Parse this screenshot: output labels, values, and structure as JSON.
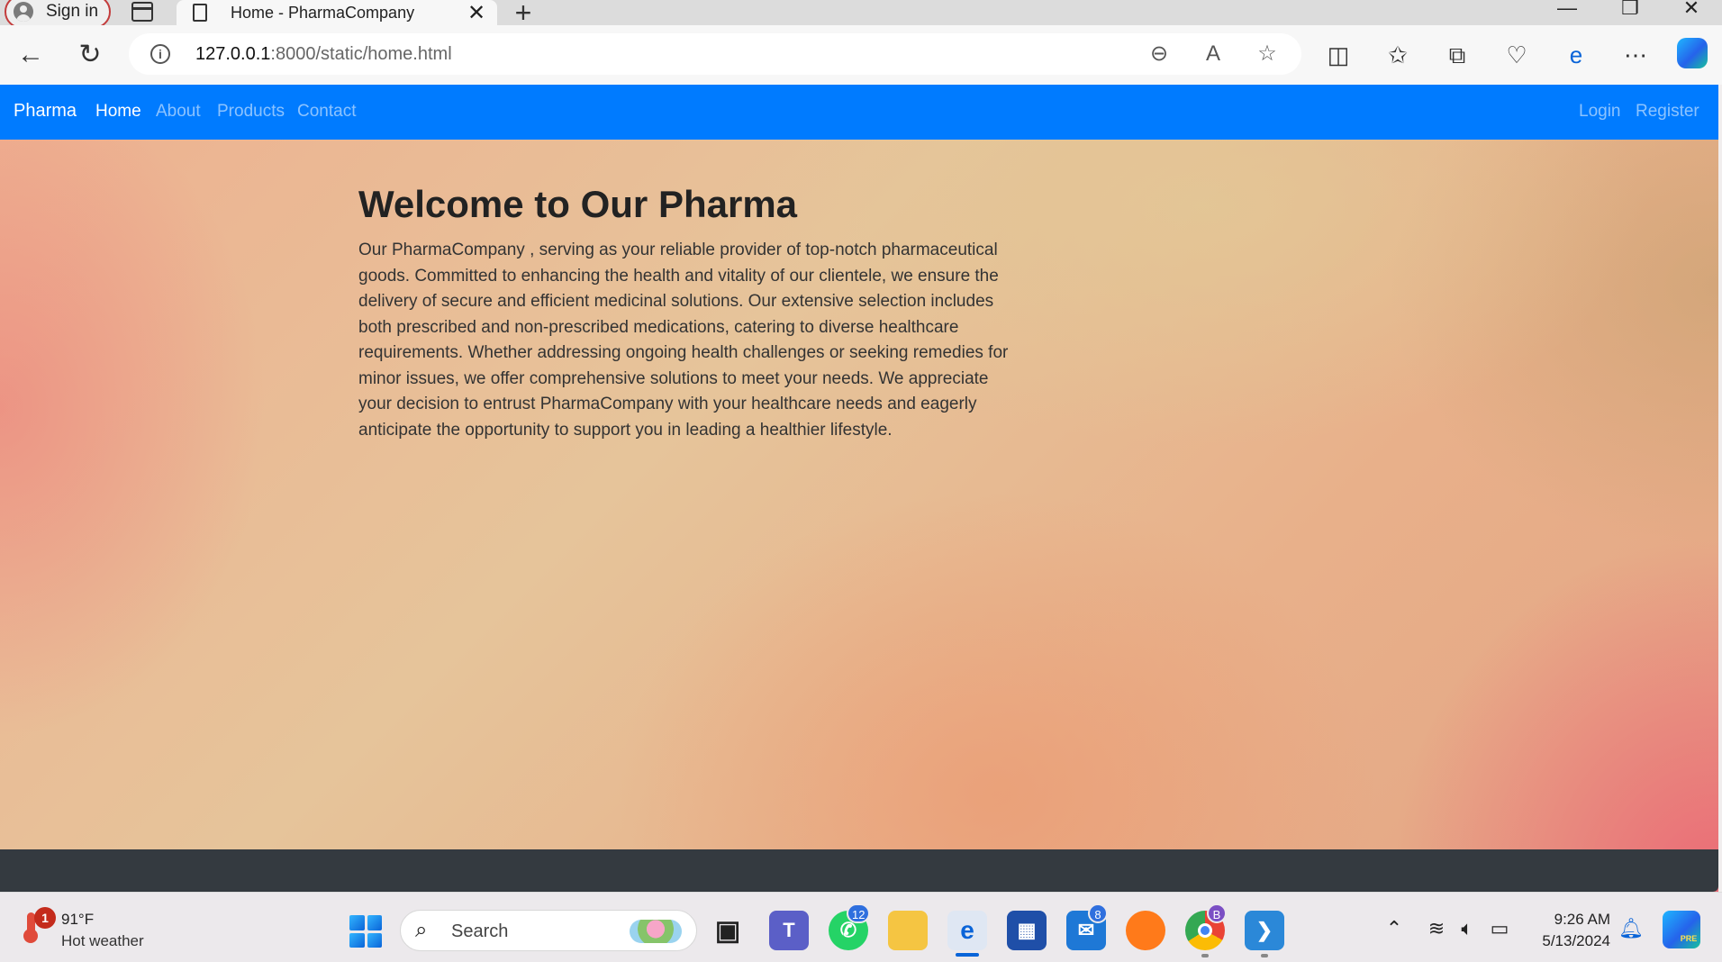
{
  "browser": {
    "profile_label": "Sign in",
    "tab_title": "Home - PharmaCompany",
    "tab_close_glyph": "✕",
    "new_tab_glyph": "+",
    "url_host": "127.0.0.1",
    "url_path": ":8000/static/home.html",
    "icons": [
      "tab-actions-icon",
      "back-icon",
      "refresh-icon",
      "info-icon",
      "zoom-out-icon",
      "read-aloud-icon",
      "favorite-star-icon",
      "split-screen-icon",
      "favorites-icon",
      "collections-icon",
      "browser-essentials-icon",
      "ie-mode-icon",
      "more-icon",
      "copilot-icon"
    ]
  },
  "navbar": {
    "brand": "Pharma",
    "links": [
      {
        "label": "Home",
        "active": true
      },
      {
        "label": "About",
        "active": false
      },
      {
        "label": "Products",
        "active": false
      },
      {
        "label": "Contact",
        "active": false
      }
    ],
    "auth": [
      {
        "label": "Login"
      },
      {
        "label": "Register"
      }
    ],
    "color": "#007bff"
  },
  "main": {
    "heading": "Welcome to Our Pharma",
    "intro": "Our PharmaCompany , serving as your reliable provider of top-notch pharmaceutical goods. Committed to enhancing the health and vitality of our clientele, we ensure the delivery of secure and efficient medicinal solutions. Our extensive selection includes both prescribed and non-prescribed medications, catering to diverse healthcare requirements. Whether addressing ongoing health challenges or seeking remedies for minor issues, we offer comprehensive solutions to meet your needs. We appreciate your decision to entrust PharmaCompany with your healthcare needs and eagerly anticipate the opportunity to support you in leading a healthier lifestyle."
  },
  "footer": {
    "color": "#343a40"
  },
  "taskbar": {
    "weather_alert_count": "1",
    "temperature": "91°F",
    "weather_text": "Hot weather",
    "search_label": "Search",
    "whatsapp_badge": "12",
    "mail_badge": "8",
    "chrome_profile_badge": "B",
    "clock_time": "9:26 AM",
    "clock_date": "5/13/2024",
    "copilot_pre_label": "PRE"
  }
}
